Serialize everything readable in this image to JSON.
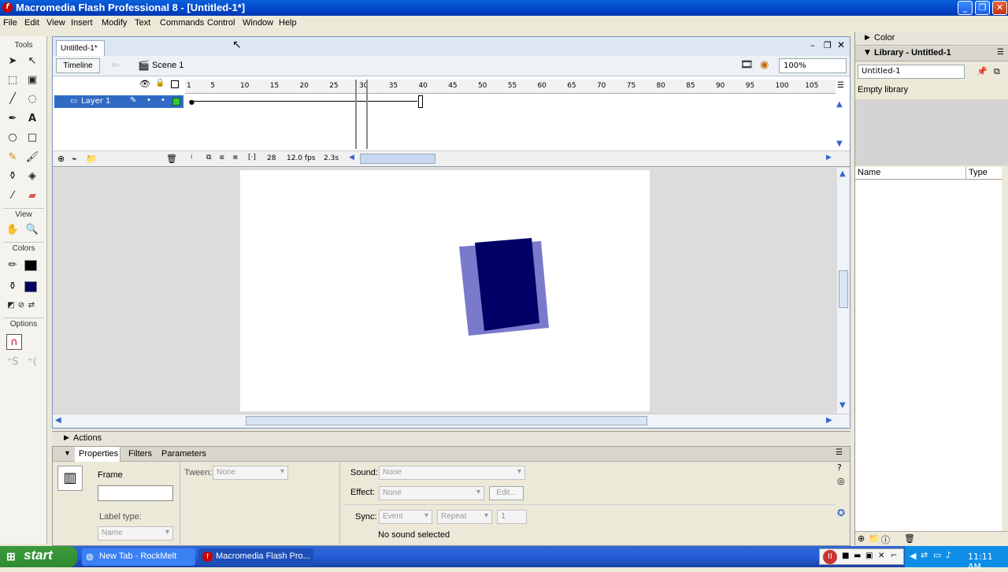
{
  "window": {
    "title": "Macromedia Flash Professional 8 - [Untitled-1*]"
  },
  "menu": [
    "File",
    "Edit",
    "View",
    "Insert",
    "Modify",
    "Text",
    "Commands",
    "Control",
    "Window",
    "Help"
  ],
  "tools": {
    "title": "Tools",
    "view": "View",
    "colors": "Colors",
    "options": "Options"
  },
  "document": {
    "tab": "Untitled-1*",
    "timeline_button": "Timeline",
    "scene": "Scene 1",
    "zoom": "100%"
  },
  "timeline": {
    "ruler": [
      "1",
      "5",
      "10",
      "15",
      "20",
      "25",
      "30",
      "35",
      "40",
      "45",
      "50",
      "55",
      "60",
      "65",
      "70",
      "75",
      "80",
      "85",
      "90",
      "95",
      "100",
      "105"
    ],
    "layer": "Layer 1",
    "current_frame": "28",
    "fps": "12.0 fps",
    "time": "2.3s"
  },
  "panels": {
    "actions": "Actions",
    "tabs": [
      "Properties",
      "Filters",
      "Parameters"
    ]
  },
  "props": {
    "frame_label": "Frame",
    "tween_label": "Tween:",
    "tween_value": "None",
    "label_type": "Label type:",
    "label_type_value": "Name",
    "sound_label": "Sound:",
    "sound_value": "None",
    "effect_label": "Effect:",
    "effect_value": "None",
    "edit_button": "Edit...",
    "sync_label": "Sync:",
    "sync_value": "Event",
    "repeat_value": "Repeat",
    "repeat_count": "1",
    "no_sound": "No sound selected"
  },
  "right": {
    "color": "Color",
    "library": "Library - Untitled-1",
    "library_select": "Untitled-1",
    "empty": "Empty library",
    "col_name": "Name",
    "col_type": "Type"
  },
  "taskbar": {
    "start": "start",
    "items": [
      "New Tab - RockMelt",
      "Macromedia Flash Pro..."
    ],
    "clock": "11:11 AM"
  }
}
